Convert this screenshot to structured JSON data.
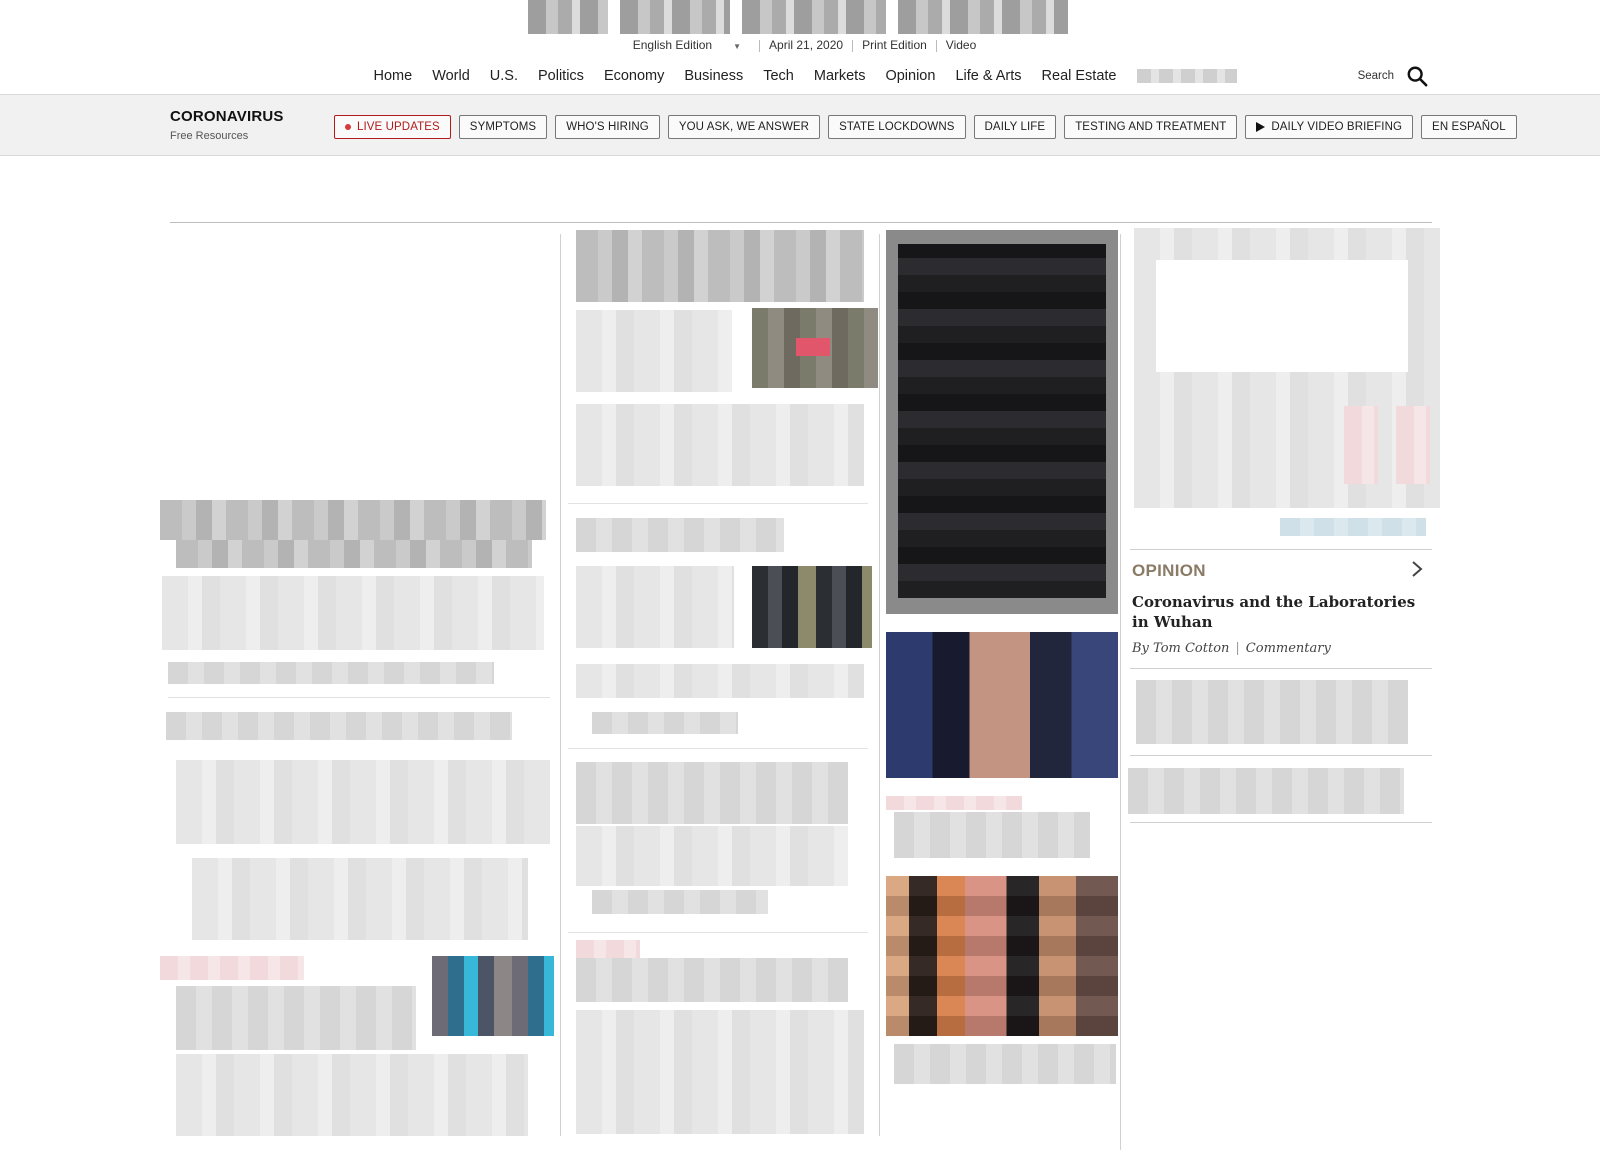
{
  "masthead": {
    "edition": "English Edition",
    "date": "April 21, 2020",
    "links": [
      "Print Edition",
      "Video"
    ]
  },
  "nav": {
    "items": [
      "Home",
      "World",
      "U.S.",
      "Politics",
      "Economy",
      "Business",
      "Tech",
      "Markets",
      "Opinion",
      "Life & Arts",
      "Real Estate"
    ],
    "search_label": "Search"
  },
  "coronavirus": {
    "title": "CORONAVIRUS",
    "subtitle": "Free Resources",
    "pills": [
      "LIVE UPDATES",
      "SYMPTOMS",
      "WHO'S HIRING",
      "YOU ASK, WE ANSWER",
      "STATE LOCKDOWNS",
      "DAILY LIFE",
      "TESTING AND TREATMENT",
      "DAILY VIDEO BRIEFING",
      "EN ESPAÑOL"
    ]
  },
  "opinion": {
    "label": "OPINION",
    "headline": "Coronavirus and the Laboratories in Wuhan",
    "author": "By Tom Cotton",
    "kind": "Commentary"
  },
  "colors": {
    "live_accent": "#b31b1b",
    "opinion_label": "#8a7a66",
    "bar_background": "#f1f1f1"
  }
}
